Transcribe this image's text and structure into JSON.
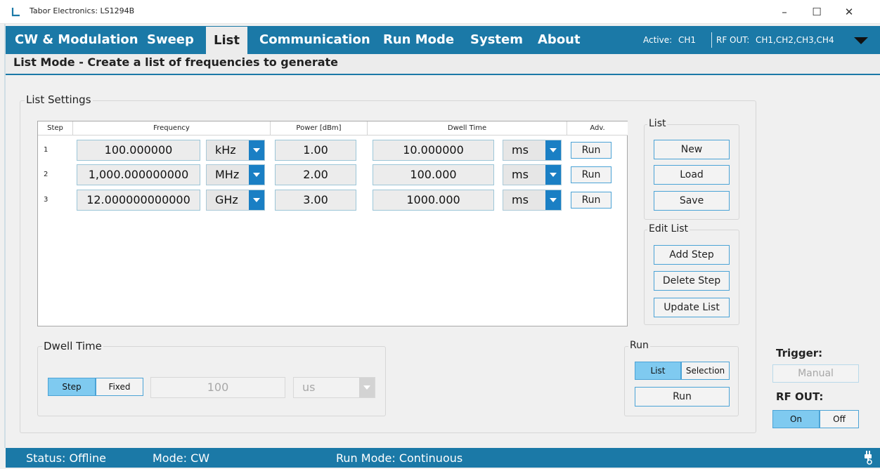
{
  "window": {
    "title": "Tabor Electronics: LS1294B",
    "minimize_glyph": "–",
    "maximize_glyph": "☐",
    "close_glyph": "✕"
  },
  "tabs": [
    {
      "label": "CW & Modulation"
    },
    {
      "label": "Sweep"
    },
    {
      "label": "List"
    },
    {
      "label": "Communication"
    },
    {
      "label": "Run Mode"
    },
    {
      "label": "System"
    },
    {
      "label": "About"
    }
  ],
  "header": {
    "active_label": "Active:",
    "active_value": "CH1",
    "rfout_label": "RF OUT:",
    "rfout_value": "CH1,CH2,CH3,CH4"
  },
  "subtitle": "List Mode - Create a list of frequencies to generate",
  "list_settings": {
    "title": "List Settings",
    "columns": [
      "Step",
      "Frequency",
      "Power [dBm]",
      "Dwell Time",
      "Adv."
    ],
    "rows": [
      {
        "step": "1",
        "frequency": "100.000000",
        "freq_unit": "kHz",
        "power": "1.00",
        "dwell": "10.000000",
        "dwell_unit": "ms",
        "adv": "Run"
      },
      {
        "step": "2",
        "frequency": "1,000.000000000",
        "freq_unit": "MHz",
        "power": "2.00",
        "dwell": "100.000",
        "dwell_unit": "ms",
        "adv": "Run"
      },
      {
        "step": "3",
        "frequency": "12.000000000000",
        "freq_unit": "GHz",
        "power": "3.00",
        "dwell": "1000.000",
        "dwell_unit": "ms",
        "adv": "Run"
      }
    ]
  },
  "list_group": {
    "title": "List",
    "new": "New",
    "load": "Load",
    "save": "Save"
  },
  "edit_group": {
    "title": "Edit List",
    "add": "Add Step",
    "delete": "Delete Step",
    "update": "Update List"
  },
  "dwell_group": {
    "title": "Dwell Time",
    "step": "Step",
    "fixed": "Fixed",
    "value": "100",
    "unit": "us"
  },
  "run_group": {
    "title": "Run",
    "list": "List",
    "selection": "Selection",
    "run": "Run"
  },
  "trigger": {
    "label": "Trigger:",
    "button": "Manual"
  },
  "rf_out": {
    "label": "RF OUT:",
    "on": "On",
    "off": "Off"
  },
  "status": {
    "status": "Status: Offline",
    "mode": "Mode: CW",
    "run_mode": "Run Mode: Continuous"
  },
  "colors": {
    "accent": "#1b79a7",
    "toggle_on": "#7fcaf0",
    "combo_button": "#1a7fc4"
  }
}
